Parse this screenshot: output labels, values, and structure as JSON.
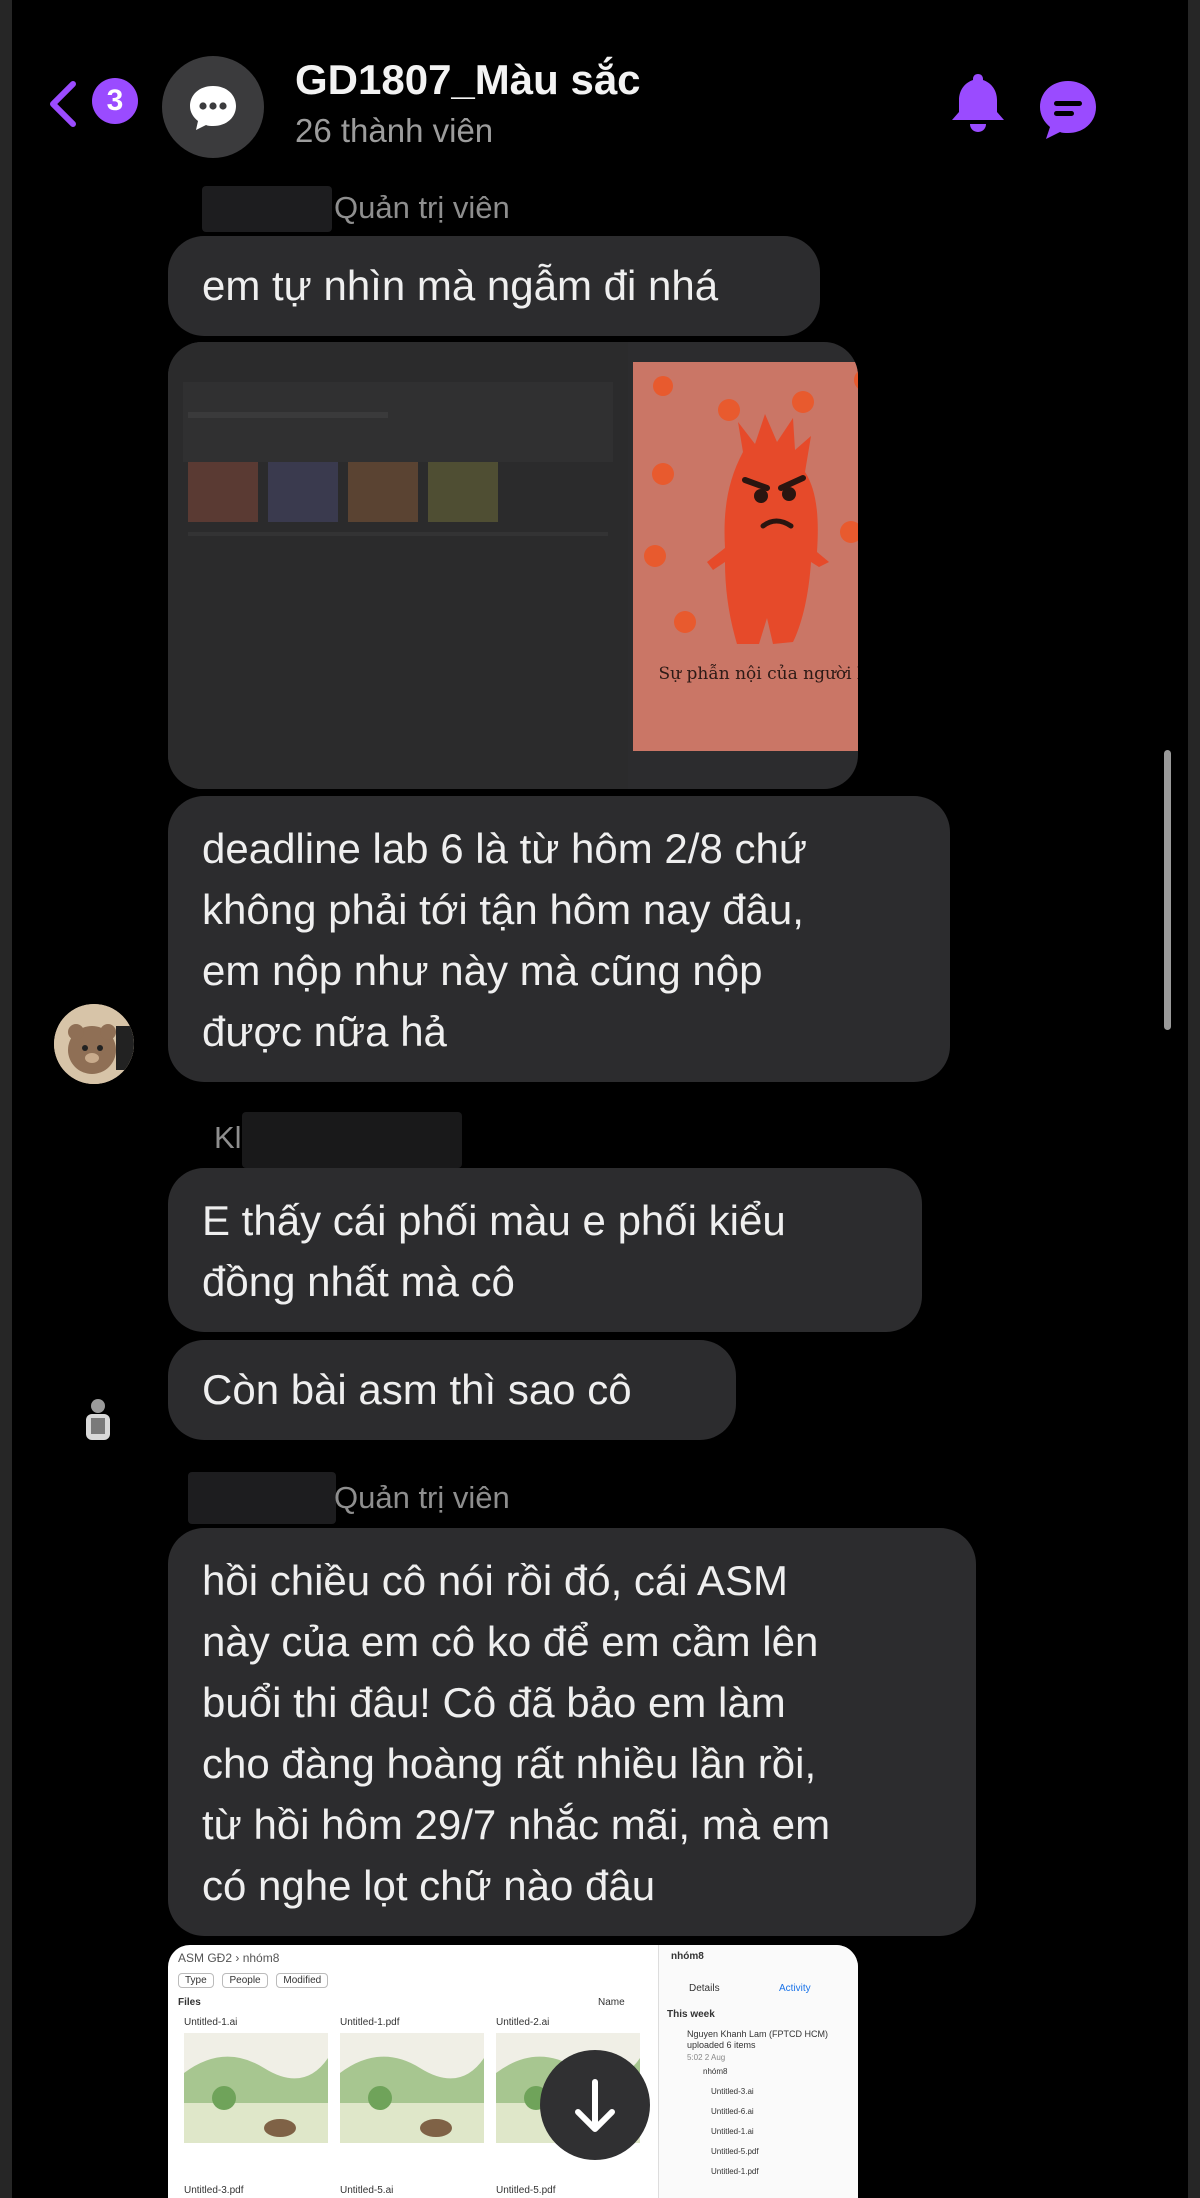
{
  "header": {
    "back_badge": "3",
    "title": "GD1807_Màu sắc",
    "subtitle": "26 thành viên"
  },
  "messages": {
    "m1_sender_role": "Quản trị viên",
    "m1_text": "em tự nhìn mà ngẫm đi nhá",
    "poster_caption": "Sự phẫn nội của người lửa",
    "m2_lines": [
      "deadline lab 6 là từ hôm 2/8 chứ",
      "không phải tới tận hôm nay đâu,",
      "em nộp như này mà cũng nộp",
      "được nữa hả"
    ],
    "m3_sender_initial": "Kl",
    "m3_lines": [
      "E thấy cái phối màu e phối kiểu",
      "đồng nhất mà cô"
    ],
    "m4_text": "Còn bài asm thì sao cô",
    "m5_sender_role": "Quản trị viên",
    "m5_lines": [
      "hồi chiều cô nói rồi đó, cái ASM",
      "này của em cô ko để em cầm lên",
      "buổi thi đâu! Cô đã bảo em làm",
      "cho đàng hoàng rất nhiều lần rồi,",
      "từ hồi hôm 29/7 nhắc mãi, mà em",
      "có nghe lọt chữ nào đâu"
    ]
  },
  "drive_screenshot": {
    "breadcrumb": [
      "ASM GĐ2",
      "nhóm8"
    ],
    "filters": [
      "Type",
      "People",
      "Modified"
    ],
    "files_label": "Files",
    "sort_label": "Name",
    "files": [
      "Untitled-1.ai",
      "Untitled-1.pdf",
      "Untitled-2.ai",
      "Untitled-3.pdf",
      "Untitled-5.ai",
      "Untitled-5.pdf"
    ],
    "panel_folder": "nhóm8",
    "panel_tabs": [
      "Details",
      "Activity"
    ],
    "panel_section": "This week",
    "panel_activity": "Nguyen Khanh Lam (FPTCD HCM) uploaded 6 items",
    "panel_date": "5:02 2 Aug",
    "panel_items": [
      "nhóm8",
      "Untitled-3.ai",
      "Untitled-6.ai",
      "Untitled-1.ai",
      "Untitled-5.pdf",
      "Untitled-1.pdf"
    ]
  },
  "colors": {
    "accent": "#9a4bff",
    "bubble": "#2c2c2e",
    "background": "#000000",
    "poster": "#ca7666"
  }
}
